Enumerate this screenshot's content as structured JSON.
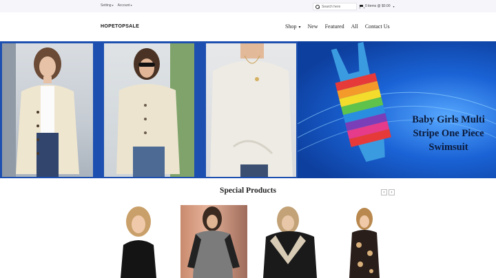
{
  "topbar": {
    "setting_label": "Setting",
    "account_label": "Account",
    "search_placeholder": "Search here",
    "cart_label": "0 items @ $0.00"
  },
  "header": {
    "logo": "HOPETOPSALE",
    "nav": [
      {
        "label": "Shop"
      },
      {
        "label": "New"
      },
      {
        "label": "Featured"
      },
      {
        "label": "All"
      },
      {
        "label": "Contact Us"
      }
    ]
  },
  "banner": {
    "promo_lines": [
      "Baby Girls Multi",
      "Stripe One Piece",
      "Swimsuit"
    ]
  },
  "special": {
    "title": "Special Products",
    "prev": "‹",
    "next": "›"
  },
  "colors": {
    "banner_blue": "#1c4fb0",
    "promo_text": "#0b1a3a"
  }
}
